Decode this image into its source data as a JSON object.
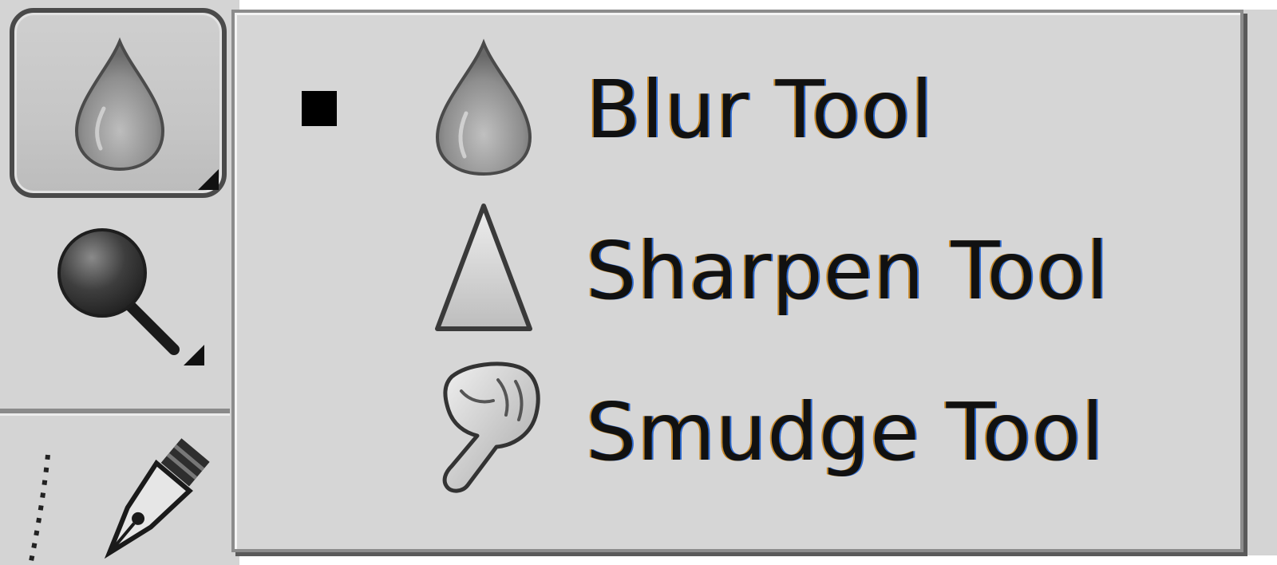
{
  "toolbar": {
    "active_tool_icon": "blur-drop-icon",
    "second_tool_icon": "dodge-icon",
    "third_tool_icon": "pen-icon"
  },
  "flyout": {
    "items": [
      {
        "label": "Blur Tool",
        "icon": "blur-drop-icon",
        "selected": true
      },
      {
        "label": "Sharpen Tool",
        "icon": "sharpen-triangle-icon",
        "selected": false
      },
      {
        "label": "Smudge Tool",
        "icon": "smudge-finger-icon",
        "selected": false
      }
    ]
  },
  "colors": {
    "panel_bg": "#d6d6d6",
    "border": "#8c8c8c",
    "text": "#111111"
  }
}
